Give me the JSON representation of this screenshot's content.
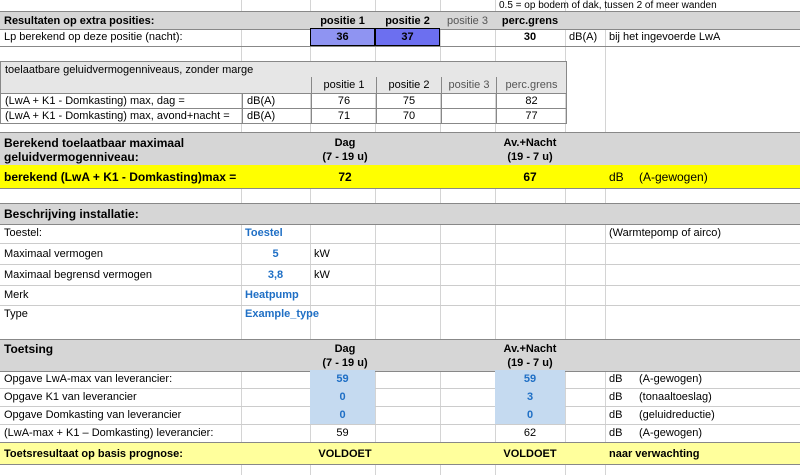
{
  "top_note": "0.5 = op bodem of dak, tussen 2 of meer wanden",
  "extra": {
    "title": "Resultaten op extra posities:",
    "headers": [
      "positie 1",
      "positie 2",
      "positie 3",
      "perc.grens"
    ],
    "lp_label": "Lp berekend op deze positie (nacht):",
    "lp_values": [
      "36",
      "37",
      "",
      "30"
    ],
    "unit": "dB(A)",
    "note": "bij het ingevoerde LwA"
  },
  "toel": {
    "title": "toelaatbare geluidvermogenniveaus, zonder marge",
    "headers": [
      "positie 1",
      "positie 2",
      "positie 3",
      "perc.grens"
    ],
    "rows": [
      {
        "label": "(LwA + K1  - Domkasting) max, dag =",
        "unit": "dB(A)",
        "values": [
          "76",
          "75",
          "",
          "82"
        ]
      },
      {
        "label": "(LwA + K1  - Domkasting) max, avond+nacht =",
        "unit": "dB(A)",
        "values": [
          "71",
          "70",
          "",
          "77"
        ]
      }
    ]
  },
  "berekend": {
    "title_line1": "Berekend toelaatbaar maximaal",
    "title_line2": "geluidvermogenniveau:",
    "dag_line1": "Dag",
    "dag_line2": "(7 - 19 u)",
    "nacht_line1": "Av.+Nacht",
    "nacht_line2": "(19 - 7 u)",
    "result_label": "berekend (LwA + K1 - Domkasting)max  =",
    "dag_value": "72",
    "nacht_value": "67",
    "unit": "dB",
    "unit_note": "(A-gewogen)"
  },
  "installatie": {
    "title": "Beschrijving installatie:",
    "toestel_label": "Toestel:",
    "toestel_value": "Toestel",
    "toestel_note": "(Warmtepomp of airco)",
    "vermogen_label": "Maximaal vermogen",
    "vermogen_value": "5",
    "vermogen_unit": "kW",
    "begrensd_label": "Maximaal begrensd vermogen",
    "begrensd_value": "3,8",
    "begrensd_unit": "kW",
    "merk_label": "Merk",
    "merk_value": "Heatpump",
    "type_label": "Type",
    "type_value": "Example_type"
  },
  "toetsing": {
    "title": "Toetsing",
    "dag_line1": "Dag",
    "dag_line2": "(7 - 19 u)",
    "nacht_line1": "Av.+Nacht",
    "nacht_line2": "(19 - 7 u)",
    "rows": [
      {
        "label": "Opgave LwA-max van leverancier:",
        "dag": "59",
        "nacht": "59",
        "unit": "dB",
        "note": "(A-gewogen)"
      },
      {
        "label": "Opgave K1 van leverancier",
        "dag": "0",
        "nacht": "3",
        "unit": "dB",
        "note": "(tonaaltoeslag)"
      },
      {
        "label": "Opgave Domkasting van leverancier",
        "dag": "0",
        "nacht": "0",
        "unit": "dB",
        "note": "(geluidreductie)"
      },
      {
        "label": "(LwA-max + K1 – Domkasting)  leverancier:",
        "dag": "59",
        "nacht": "62",
        "unit": "dB",
        "note": "(A-gewogen)"
      }
    ],
    "result_label": "Toetsresultaat op basis prognose:",
    "result_dag": "VOLDOET",
    "result_nacht": "VOLDOET",
    "result_note": "naar verwachting"
  }
}
